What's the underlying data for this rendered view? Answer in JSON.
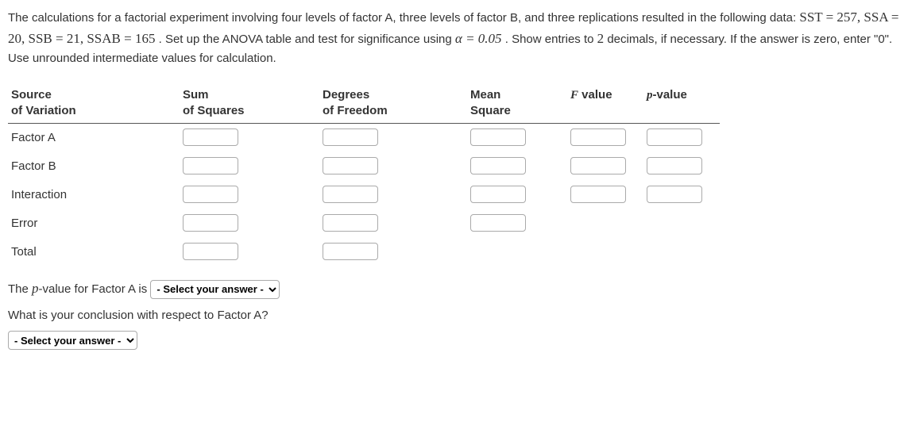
{
  "problem": {
    "line1a": "The calculations for a factorial experiment involving four levels of factor A, three levels of factor B, and three replications resulted in the following data: ",
    "eq": "SST = 257, SSA = 20, SSB = 21, SSAB = 165",
    "line1b": ". Set up the ANOVA table and test for significance using ",
    "alpha": "α = 0.05",
    "line1c": ". Show entries to ",
    "two": "2",
    "line1d": " decimals, if necessary. If the answer is zero, enter \"0\". Use unrounded intermediate values for calculation."
  },
  "headers": {
    "source1": "Source",
    "source2": "of Variation",
    "ss1": "Sum",
    "ss2": "of Squares",
    "df1": "Degrees",
    "df2": "of Freedom",
    "ms1": "Mean",
    "ms2": "Square",
    "f": "F value",
    "p": "p-value"
  },
  "rows": {
    "factorA": "Factor A",
    "factorB": "Factor B",
    "interaction": "Interaction",
    "error": "Error",
    "total": "Total"
  },
  "after": {
    "pvalA_pre": "The ",
    "pvalA_p": "p",
    "pvalA_post": "-value for Factor A is ",
    "conclusionA": "What is your conclusion with respect to Factor A?",
    "select_placeholder": "- Select your answer -"
  }
}
